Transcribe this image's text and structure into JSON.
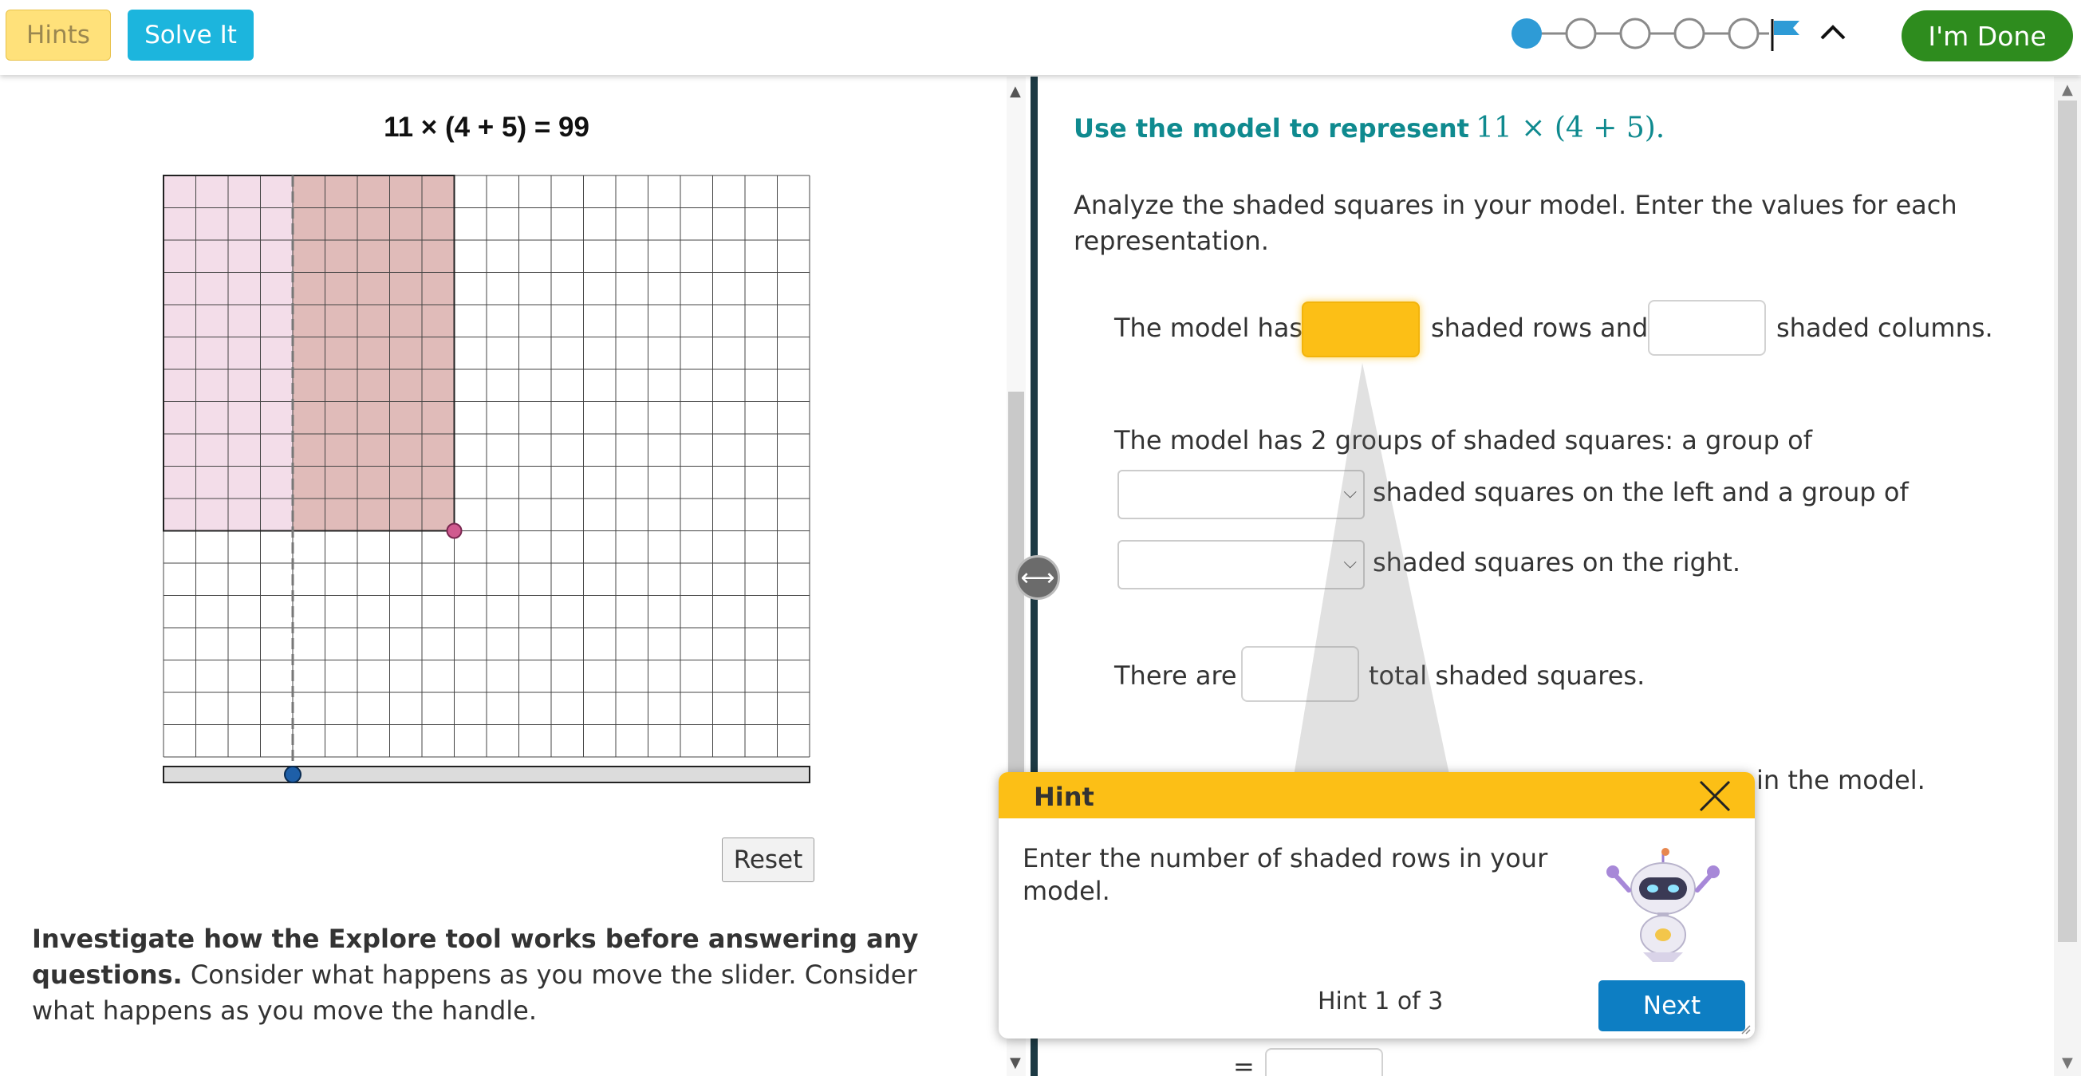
{
  "toolbar": {
    "hints_label": "Hints",
    "solve_label": "Solve It",
    "done_label": "I'm Done",
    "progress_steps": 5,
    "progress_current": 1
  },
  "left": {
    "equation": "11 × (4 + 5) = 99",
    "reset_label": "Reset",
    "instructions_bold": "Investigate how the Explore tool works before answering any questions.",
    "instructions_rest": " Consider what happens as you move the slider. Consider what happens as you move the handle.",
    "grid": {
      "columns": 20,
      "rows": 18,
      "shaded_rows": 11,
      "shaded_left_columns": 4,
      "shaded_right_columns": 5,
      "colors": {
        "left": "#f3dde9",
        "right": "#e0bbb9",
        "handle": "#d05a8f",
        "slider_knob": "#1e5fa8"
      }
    }
  },
  "right": {
    "title": "Use the model to represent",
    "title_expr": "11 × (4 + 5).",
    "intro": "Analyze the shaded squares in your model. Enter the values for each representation.",
    "q1_a": "The model has",
    "q1_b": "shaded rows and",
    "q1_c": "shaded columns.",
    "q2_a": "The model has 2 groups of shaded squares: a group of",
    "q2_b": "shaded squares on the left and a group of",
    "q2_c": "shaded squares on the right.",
    "q3_a": "There are",
    "q3_b": "total shaded squares.",
    "q4_tail": "in the model.",
    "eq_sign": "="
  },
  "hint": {
    "title": "Hint",
    "body": "Enter the number of shaded rows in your model.",
    "count": "Hint 1 of 3",
    "next_label": "Next"
  }
}
